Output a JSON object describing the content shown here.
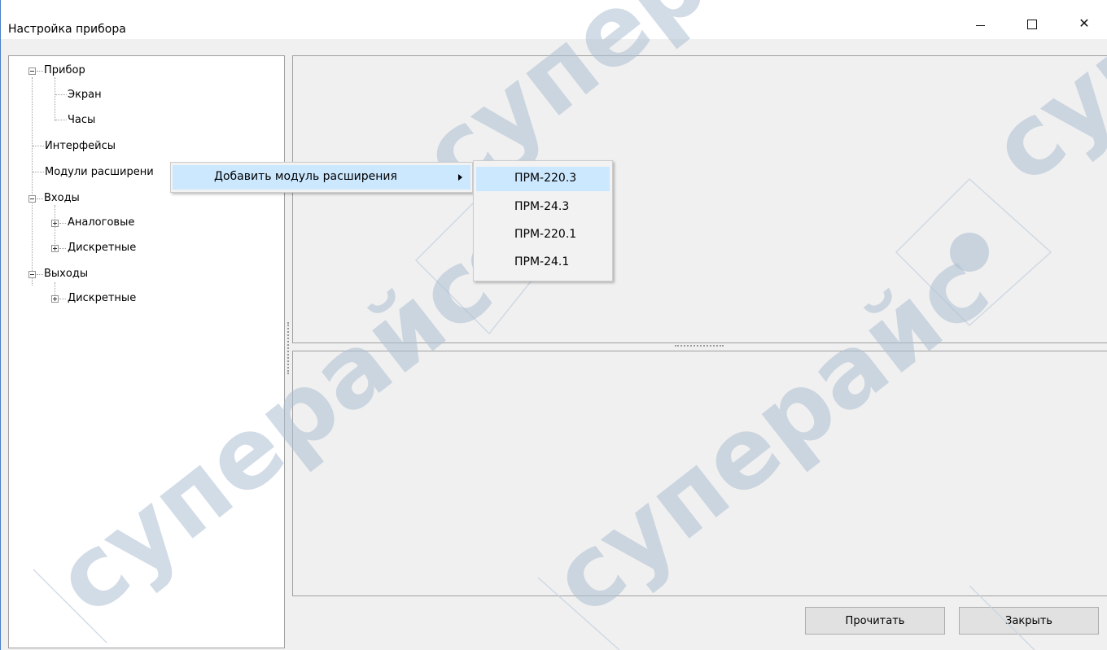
{
  "window": {
    "title": "Настройка прибора",
    "controls": {
      "minimize": "minimize",
      "maximize": "maximize",
      "close": "close"
    }
  },
  "tree": {
    "items": [
      {
        "label": "Прибор"
      },
      {
        "label": "Экран"
      },
      {
        "label": "Часы"
      },
      {
        "label": "Интерфейсы"
      },
      {
        "label": "Модули расширени"
      },
      {
        "label": "Входы"
      },
      {
        "label": "Аналоговые"
      },
      {
        "label": "Дискретные"
      },
      {
        "label": "Выходы"
      },
      {
        "label": "Дискретные"
      }
    ]
  },
  "context_menu": {
    "item": "Добавить модуль расширения",
    "submenu": [
      "ПРМ-220.3",
      "ПРМ-24.3",
      "ПРМ-220.1",
      "ПРМ-24.1"
    ],
    "highlighted": "ПРМ-220.3"
  },
  "buttons": {
    "read": "Прочитать",
    "close": "Закрыть"
  },
  "watermark": {
    "text": "cyпeрайс",
    "color": "#9bb0c8"
  },
  "colors": {
    "menu_highlight": "#cce8ff",
    "window_border": "#4a7fc7"
  }
}
